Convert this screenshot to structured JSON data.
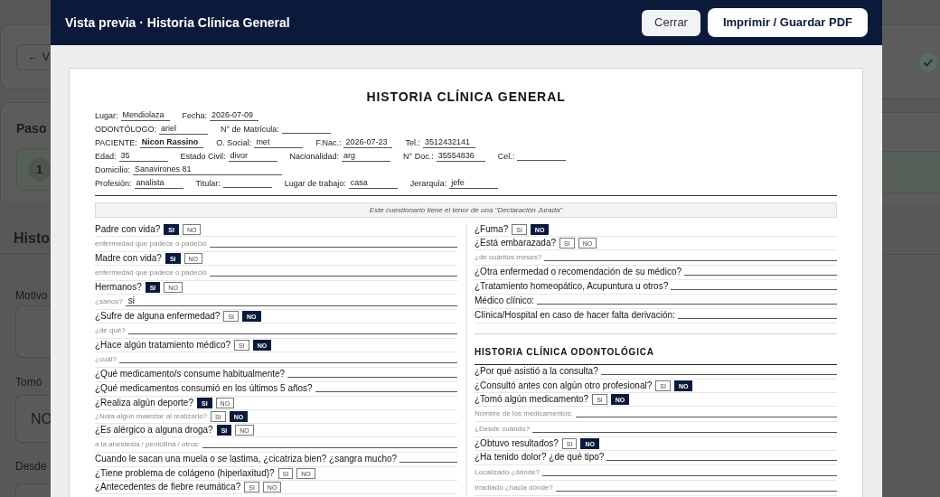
{
  "background_page": {
    "back_button": "← V",
    "step_label": "Paso",
    "stepper": {
      "number": "1"
    },
    "heading": "Histo",
    "fields": [
      {
        "kind": "textarea",
        "label": "Motivo"
      },
      {
        "kind": "select",
        "label": "Tomó",
        "value": "NO"
      },
      {
        "kind": "text",
        "label": "Desde"
      }
    ]
  },
  "dialog": {
    "title": "Vista previa · Historia Clínica General",
    "buttons": [
      {
        "kind": "secondary",
        "label": "Cerrar"
      },
      {
        "kind": "primary",
        "label": "Imprimir / Guardar PDF"
      }
    ]
  },
  "document": {
    "title": "HISTORIA CLÍNICA GENERAL",
    "header_rows": [
      [
        {
          "label": "Lugar:",
          "value": "Mendiolaza"
        },
        {
          "label": "Fecha:",
          "value": "2026-07-09"
        }
      ],
      [
        {
          "label": "ODONTÓLOGO:",
          "value": "ariel"
        },
        {
          "label": "N° de Matrícula:"
        }
      ],
      [
        {
          "label": "PACIENTE:",
          "value": "Nicon Rassino",
          "bold": true
        },
        {
          "label": "O. Social:",
          "value": "met"
        },
        {
          "label": "F.Nac.:",
          "value": "2026-07-23"
        },
        {
          "label": "Tel.:",
          "value": "3512432141"
        }
      ],
      [
        {
          "label": "Edad:",
          "value": "35"
        },
        {
          "label": "Estado Civil:",
          "value": "divor"
        },
        {
          "label": "Nacionalidad:",
          "value": "arg"
        },
        {
          "label": "N° Doc.:",
          "value": "35554836"
        },
        {
          "label": "Cel.:"
        }
      ],
      [
        {
          "label": "Domicilio:",
          "value": "Sanavirones 81"
        }
      ],
      [
        {
          "label": "Profesión:",
          "value": "analista"
        },
        {
          "label": "Titular:"
        },
        {
          "label": "Lugar de trabajo:",
          "value": "casa"
        },
        {
          "label": "Jerarquía:",
          "value": "jefe"
        }
      ]
    ],
    "notice": "Este cuestionario tiene el tenor de una \"Declaración Jurada\"",
    "columns": [
      {
        "items": [
          {
            "kind": "yesno",
            "text": "Padre con vida?",
            "options": [
              {
                "label": "SI",
                "selected": true
              },
              {
                "label": "NO",
                "selected": false
              }
            ]
          },
          {
            "kind": "sub",
            "text": "enfermedad que padece o padeció"
          },
          {
            "kind": "yesno",
            "text": "Madre con vida?",
            "options": [
              {
                "label": "SI",
                "selected": true
              },
              {
                "label": "NO",
                "selected": false
              }
            ]
          },
          {
            "kind": "sub",
            "text": "enfermedad que padece o padeció"
          },
          {
            "kind": "yesno",
            "text": "Hermanos?",
            "options": [
              {
                "label": "SI",
                "selected": true
              },
              {
                "label": "NO",
                "selected": false
              }
            ]
          },
          {
            "kind": "sub",
            "text": "¿sanos?",
            "value": "si"
          },
          {
            "kind": "yesno",
            "text": "¿Sufre de alguna enfermedad?",
            "options": [
              {
                "label": "SI",
                "selected": false
              },
              {
                "label": "NO",
                "selected": true
              }
            ]
          },
          {
            "kind": "sub",
            "text": "¿de qué?"
          },
          {
            "kind": "yesno",
            "text": "¿Hace algún tratamiento médico?",
            "options": [
              {
                "label": "SI",
                "selected": false
              },
              {
                "label": "NO",
                "selected": true
              }
            ]
          },
          {
            "kind": "sub",
            "text": "¿cuál?"
          },
          {
            "kind": "line",
            "text": "¿Qué medicamento/s consume habitualmente?"
          },
          {
            "kind": "line",
            "text": "¿Qué medicamentos consumió en los últimos 5 años?"
          },
          {
            "kind": "yesno",
            "text": "¿Realiza algún deporte?",
            "options": [
              {
                "label": "SI",
                "selected": true
              },
              {
                "label": "NO",
                "selected": false
              }
            ]
          },
          {
            "kind": "sub_yesno",
            "text": "¿Nota algún malestar al realizarlo?",
            "options": [
              {
                "label": "SI",
                "selected": false
              },
              {
                "label": "NO",
                "selected": true
              }
            ]
          },
          {
            "kind": "yesno",
            "text": "¿Es alérgico a alguna droga?",
            "options": [
              {
                "label": "SI",
                "selected": true
              },
              {
                "label": "NO",
                "selected": false
              }
            ]
          },
          {
            "kind": "sub",
            "text": "a la anestesia / penicilina / otros:"
          },
          {
            "kind": "line",
            "text": "Cuando le sacan una muela o se lastima, ¿cicatriza bien? ¿sangra mucho?"
          },
          {
            "kind": "yesno",
            "text": "¿Tiene problema de colágeno (hiperlaxitud)?",
            "options": [
              {
                "label": "SI",
                "selected": false
              },
              {
                "label": "NO",
                "selected": false
              }
            ]
          },
          {
            "kind": "yesno",
            "text": "¿Antecedentes de fiebre reumática?",
            "options": [
              {
                "label": "SI",
                "selected": false
              },
              {
                "label": "NO",
                "selected": false
              }
            ]
          }
        ]
      },
      {
        "items": [
          {
            "kind": "yesno",
            "text": "¿Fuma?",
            "options": [
              {
                "label": "SI",
                "selected": false
              },
              {
                "label": "NO",
                "selected": true
              }
            ]
          },
          {
            "kind": "yesno",
            "text": "¿Está embarazada?",
            "options": [
              {
                "label": "SI",
                "selected": false
              },
              {
                "label": "NO",
                "selected": false
              }
            ]
          },
          {
            "kind": "sub",
            "text": "¿de cuántos meses?"
          },
          {
            "kind": "line",
            "text": "¿Otra enfermedad o recomendación de su médico?"
          },
          {
            "kind": "line",
            "text": "¿Tratamiento homeopático, Acupuntura u otros?"
          },
          {
            "kind": "line",
            "text": "Médico clínico:"
          },
          {
            "kind": "line",
            "text": "Clínica/Hospital en caso de hacer falta derivación:"
          },
          {
            "kind": "heading",
            "text": "HISTORIA CLÍNICA ODONTOLÓGICA"
          },
          {
            "kind": "line",
            "text": "¿Por qué asistió a la consulta?"
          },
          {
            "kind": "yesno",
            "text": "¿Consultó antes con algún otro profesional?",
            "options": [
              {
                "label": "SI",
                "selected": false
              },
              {
                "label": "NO",
                "selected": true
              }
            ]
          },
          {
            "kind": "yesno",
            "text": "¿Tomó algún medicamento?",
            "options": [
              {
                "label": "SI",
                "selected": false
              },
              {
                "label": "NO",
                "selected": true
              }
            ]
          },
          {
            "kind": "sub",
            "text": "Nombre de los medicamentos:"
          },
          {
            "kind": "sub",
            "text": "¿Desde cuándo?"
          },
          {
            "kind": "yesno",
            "text": "¿Obtuvo resultados?",
            "options": [
              {
                "label": "SI",
                "selected": false
              },
              {
                "label": "NO",
                "selected": true
              }
            ]
          },
          {
            "kind": "line",
            "text": "¿Ha tenido dolor? ¿de qué tipo?"
          },
          {
            "kind": "sub",
            "text": "Localizado ¿dónde?"
          },
          {
            "kind": "sub",
            "text": "Irradiado ¿hacia dónde?"
          }
        ]
      }
    ]
  }
}
